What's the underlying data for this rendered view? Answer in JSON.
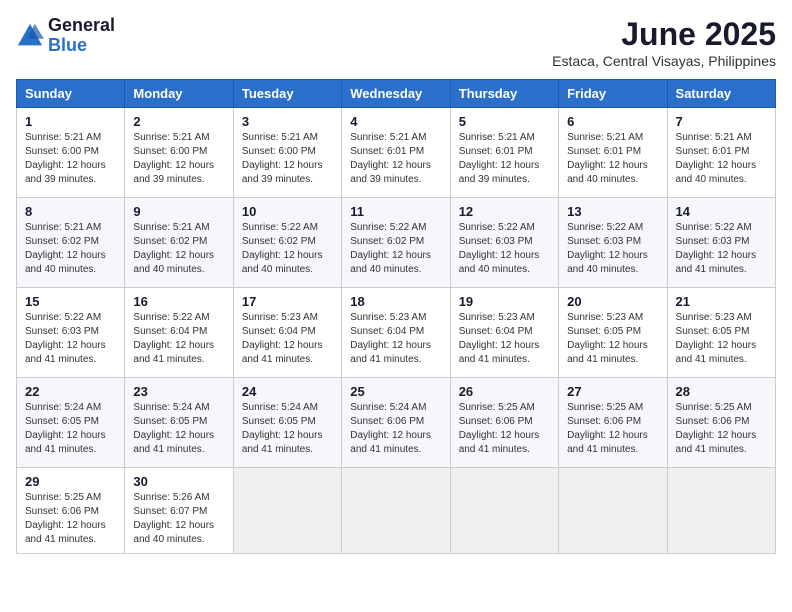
{
  "logo": {
    "general": "General",
    "blue": "Blue"
  },
  "title": "June 2025",
  "location": "Estaca, Central Visayas, Philippines",
  "days_header": [
    "Sunday",
    "Monday",
    "Tuesday",
    "Wednesday",
    "Thursday",
    "Friday",
    "Saturday"
  ],
  "weeks": [
    [
      {
        "day": "1",
        "sunrise": "5:21 AM",
        "sunset": "6:00 PM",
        "daylight": "12 hours and 39 minutes."
      },
      {
        "day": "2",
        "sunrise": "5:21 AM",
        "sunset": "6:00 PM",
        "daylight": "12 hours and 39 minutes."
      },
      {
        "day": "3",
        "sunrise": "5:21 AM",
        "sunset": "6:00 PM",
        "daylight": "12 hours and 39 minutes."
      },
      {
        "day": "4",
        "sunrise": "5:21 AM",
        "sunset": "6:01 PM",
        "daylight": "12 hours and 39 minutes."
      },
      {
        "day": "5",
        "sunrise": "5:21 AM",
        "sunset": "6:01 PM",
        "daylight": "12 hours and 39 minutes."
      },
      {
        "day": "6",
        "sunrise": "5:21 AM",
        "sunset": "6:01 PM",
        "daylight": "12 hours and 40 minutes."
      },
      {
        "day": "7",
        "sunrise": "5:21 AM",
        "sunset": "6:01 PM",
        "daylight": "12 hours and 40 minutes."
      }
    ],
    [
      {
        "day": "8",
        "sunrise": "5:21 AM",
        "sunset": "6:02 PM",
        "daylight": "12 hours and 40 minutes."
      },
      {
        "day": "9",
        "sunrise": "5:21 AM",
        "sunset": "6:02 PM",
        "daylight": "12 hours and 40 minutes."
      },
      {
        "day": "10",
        "sunrise": "5:22 AM",
        "sunset": "6:02 PM",
        "daylight": "12 hours and 40 minutes."
      },
      {
        "day": "11",
        "sunrise": "5:22 AM",
        "sunset": "6:02 PM",
        "daylight": "12 hours and 40 minutes."
      },
      {
        "day": "12",
        "sunrise": "5:22 AM",
        "sunset": "6:03 PM",
        "daylight": "12 hours and 40 minutes."
      },
      {
        "day": "13",
        "sunrise": "5:22 AM",
        "sunset": "6:03 PM",
        "daylight": "12 hours and 40 minutes."
      },
      {
        "day": "14",
        "sunrise": "5:22 AM",
        "sunset": "6:03 PM",
        "daylight": "12 hours and 41 minutes."
      }
    ],
    [
      {
        "day": "15",
        "sunrise": "5:22 AM",
        "sunset": "6:03 PM",
        "daylight": "12 hours and 41 minutes."
      },
      {
        "day": "16",
        "sunrise": "5:22 AM",
        "sunset": "6:04 PM",
        "daylight": "12 hours and 41 minutes."
      },
      {
        "day": "17",
        "sunrise": "5:23 AM",
        "sunset": "6:04 PM",
        "daylight": "12 hours and 41 minutes."
      },
      {
        "day": "18",
        "sunrise": "5:23 AM",
        "sunset": "6:04 PM",
        "daylight": "12 hours and 41 minutes."
      },
      {
        "day": "19",
        "sunrise": "5:23 AM",
        "sunset": "6:04 PM",
        "daylight": "12 hours and 41 minutes."
      },
      {
        "day": "20",
        "sunrise": "5:23 AM",
        "sunset": "6:05 PM",
        "daylight": "12 hours and 41 minutes."
      },
      {
        "day": "21",
        "sunrise": "5:23 AM",
        "sunset": "6:05 PM",
        "daylight": "12 hours and 41 minutes."
      }
    ],
    [
      {
        "day": "22",
        "sunrise": "5:24 AM",
        "sunset": "6:05 PM",
        "daylight": "12 hours and 41 minutes."
      },
      {
        "day": "23",
        "sunrise": "5:24 AM",
        "sunset": "6:05 PM",
        "daylight": "12 hours and 41 minutes."
      },
      {
        "day": "24",
        "sunrise": "5:24 AM",
        "sunset": "6:05 PM",
        "daylight": "12 hours and 41 minutes."
      },
      {
        "day": "25",
        "sunrise": "5:24 AM",
        "sunset": "6:06 PM",
        "daylight": "12 hours and 41 minutes."
      },
      {
        "day": "26",
        "sunrise": "5:25 AM",
        "sunset": "6:06 PM",
        "daylight": "12 hours and 41 minutes."
      },
      {
        "day": "27",
        "sunrise": "5:25 AM",
        "sunset": "6:06 PM",
        "daylight": "12 hours and 41 minutes."
      },
      {
        "day": "28",
        "sunrise": "5:25 AM",
        "sunset": "6:06 PM",
        "daylight": "12 hours and 41 minutes."
      }
    ],
    [
      {
        "day": "29",
        "sunrise": "5:25 AM",
        "sunset": "6:06 PM",
        "daylight": "12 hours and 41 minutes."
      },
      {
        "day": "30",
        "sunrise": "5:26 AM",
        "sunset": "6:07 PM",
        "daylight": "12 hours and 40 minutes."
      },
      null,
      null,
      null,
      null,
      null
    ]
  ]
}
